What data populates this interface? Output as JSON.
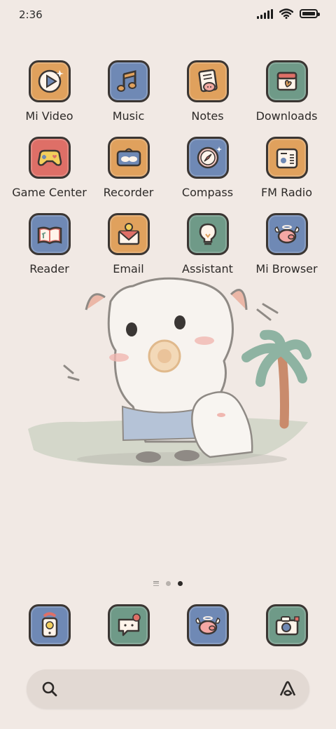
{
  "status_bar": {
    "time": "2:36",
    "battery_level": 1.0
  },
  "colors": {
    "background": "#f1e9e4",
    "tile_orange": "#e0a15d",
    "tile_blue": "#6f89b5",
    "tile_green": "#6f9a88",
    "tile_red": "#de6f67",
    "outline": "#3b3633"
  },
  "apps": [
    {
      "label": "Mi Video",
      "icon": "play-icon",
      "tile": "orange"
    },
    {
      "label": "Music",
      "icon": "music-note-icon",
      "tile": "blue"
    },
    {
      "label": "Notes",
      "icon": "notes-icon",
      "tile": "orange"
    },
    {
      "label": "Downloads",
      "icon": "download-box-icon",
      "tile": "green"
    },
    {
      "label": "Game Center",
      "icon": "gamepad-icon",
      "tile": "red"
    },
    {
      "label": "Recorder",
      "icon": "cassette-icon",
      "tile": "orange"
    },
    {
      "label": "Compass",
      "icon": "compass-icon",
      "tile": "blue"
    },
    {
      "label": "FM Radio",
      "icon": "radio-icon",
      "tile": "orange"
    },
    {
      "label": "Reader",
      "icon": "book-icon",
      "tile": "blue"
    },
    {
      "label": "Email",
      "icon": "envelope-icon",
      "tile": "orange"
    },
    {
      "label": "Assistant",
      "icon": "lightbulb-icon",
      "tile": "green"
    },
    {
      "label": "Mi Browser",
      "icon": "flying-pig-icon",
      "tile": "blue"
    }
  ],
  "dock": [
    {
      "icon": "phone-icon",
      "tile": "blue"
    },
    {
      "icon": "message-bubble-icon",
      "tile": "green"
    },
    {
      "icon": "flying-pig-icon",
      "tile": "blue"
    },
    {
      "icon": "camera-icon",
      "tile": "green"
    }
  ],
  "pager": {
    "pages": 2,
    "active": 2
  },
  "search_bar": {
    "left_icon": "search-icon",
    "right_icon": "assistant-a-icon"
  }
}
